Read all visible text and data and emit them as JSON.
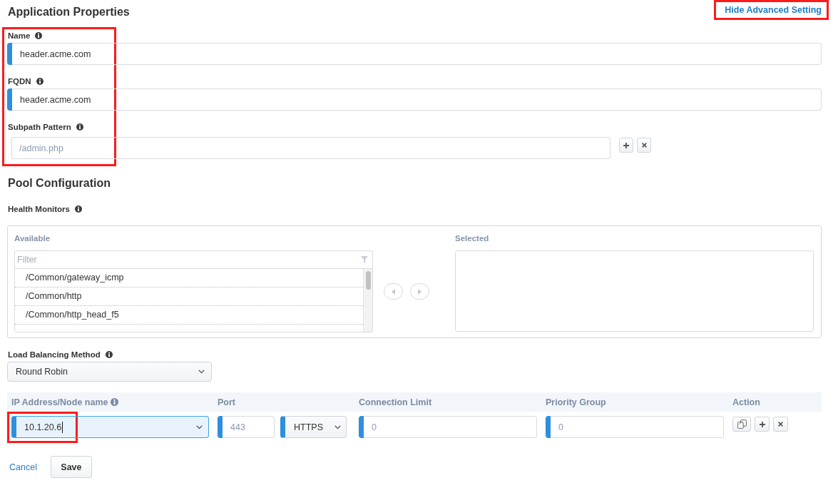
{
  "advanced_link": {
    "label": "Hide Advanced Setting",
    "highlighted": true
  },
  "application_properties": {
    "title": "Application Properties",
    "highlighted": true,
    "fields": [
      {
        "kind": "text",
        "label": "Name",
        "info": true,
        "required": true,
        "value": "header.acme.com"
      },
      {
        "kind": "text",
        "label": "FQDN",
        "info": true,
        "required": true,
        "value": "header.acme.com"
      },
      {
        "kind": "repeatable",
        "label": "Subpath Pattern",
        "info": true,
        "required": false,
        "placeholder": "/admin.php"
      }
    ]
  },
  "pool_configuration": {
    "title": "Pool Configuration",
    "health_monitors": {
      "label": "Health Monitors",
      "info": true,
      "available_label": "Available",
      "filter_placeholder": "Filter",
      "available": [
        {
          "label": "/Common/gateway_icmp",
          "selected": false
        },
        {
          "label": "/Common/http",
          "selected": false
        },
        {
          "label": "/Common/http_head_f5",
          "selected": false
        }
      ],
      "selected_label": "Selected"
    },
    "load_balancing": {
      "label": "Load Balancing Method",
      "info": true,
      "value": "Round Robin"
    },
    "members": {
      "columns": [
        {
          "label": "IP Address/Node name",
          "info": true
        },
        {
          "label": "Port",
          "info": false
        },
        {
          "label": "Connection Limit",
          "info": false
        },
        {
          "label": "Priority Group",
          "info": false
        },
        {
          "label": "Action",
          "info": false
        }
      ],
      "rows": [
        {
          "node": {
            "value": "10.1.20.6",
            "required": true,
            "focused": true,
            "highlighted": true
          },
          "port": {
            "placeholder": "443",
            "required": true
          },
          "protocol": {
            "value": "HTTPS",
            "required": true
          },
          "connection_limit": {
            "placeholder": "0",
            "required": true
          },
          "priority_group": {
            "placeholder": "0",
            "required": true
          }
        }
      ]
    }
  },
  "footer": {
    "cancel": "Cancel",
    "save": "Save"
  }
}
